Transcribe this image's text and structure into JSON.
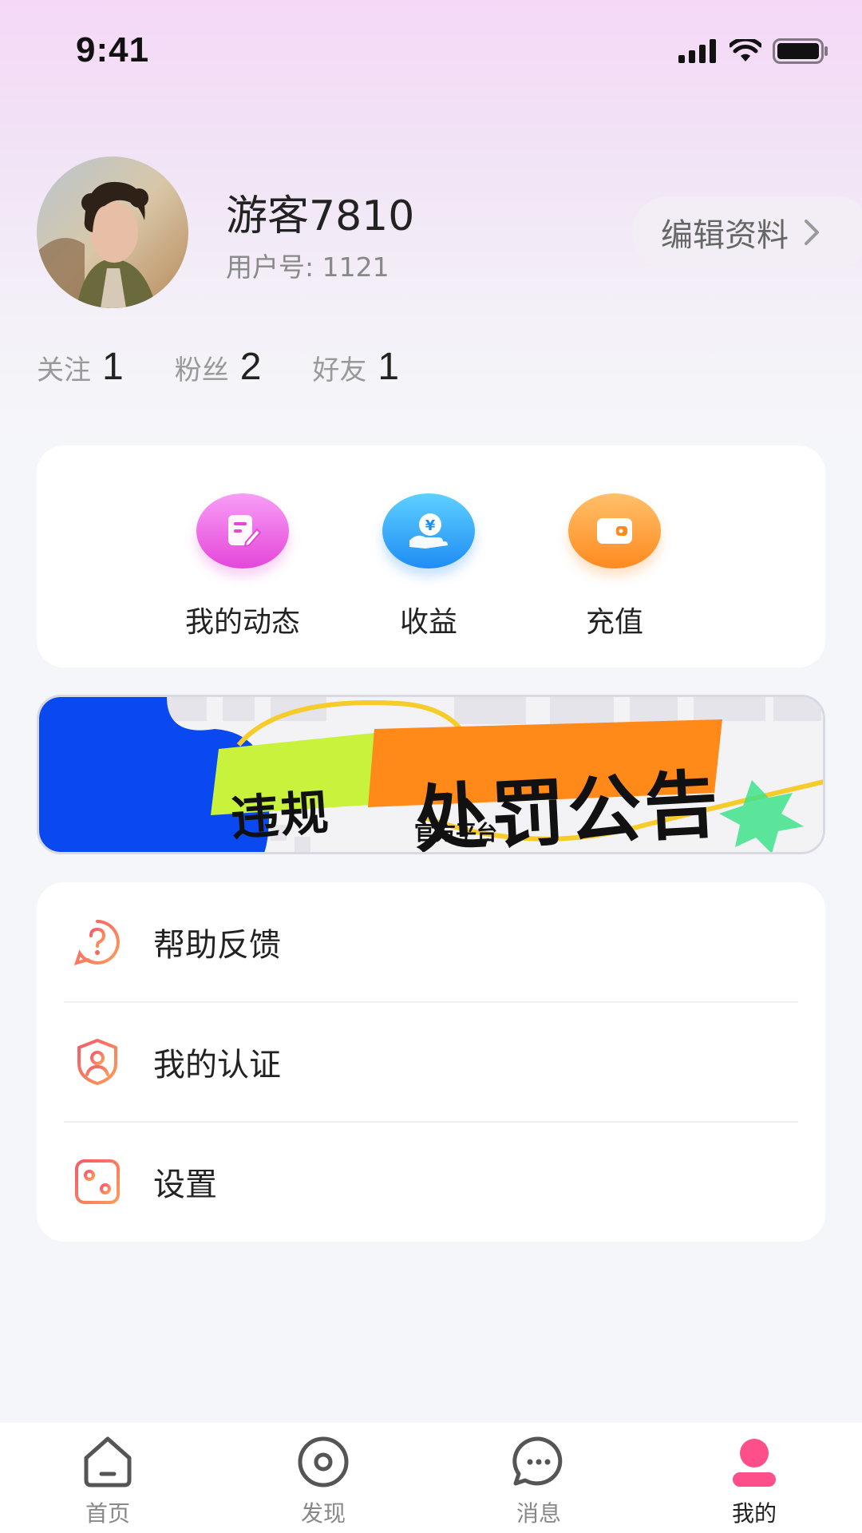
{
  "status_bar": {
    "time": "9:41"
  },
  "profile": {
    "username": "游客7810",
    "user_id_label": "用户号:",
    "user_id": "1121",
    "edit_label": "编辑资料"
  },
  "stats": [
    {
      "label": "关注",
      "value": "1"
    },
    {
      "label": "粉丝",
      "value": "2"
    },
    {
      "label": "好友",
      "value": "1"
    }
  ],
  "quick_actions": [
    {
      "label": "我的动态",
      "icon": "document-edit-icon",
      "color": "#e546d9"
    },
    {
      "label": "收益",
      "icon": "money-hand-icon",
      "color": "#1f8df5"
    },
    {
      "label": "充值",
      "icon": "wallet-icon",
      "color": "#ff8a1f"
    }
  ],
  "banner": {
    "tag": "违规",
    "title": "处罚公告",
    "subtitle": "官方平台"
  },
  "menu": [
    {
      "label": "帮助反馈",
      "icon": "help-icon"
    },
    {
      "label": "我的认证",
      "icon": "shield-user-icon"
    },
    {
      "label": "设置",
      "icon": "settings-icon"
    }
  ],
  "tabs": [
    {
      "label": "首页",
      "icon": "home-icon",
      "active": false
    },
    {
      "label": "发现",
      "icon": "discover-icon",
      "active": false
    },
    {
      "label": "消息",
      "icon": "message-icon",
      "active": false
    },
    {
      "label": "我的",
      "icon": "profile-icon",
      "active": true
    }
  ],
  "colors": {
    "accent_pink": "#ff4f8b",
    "menu_icon": "#f46a5a"
  }
}
